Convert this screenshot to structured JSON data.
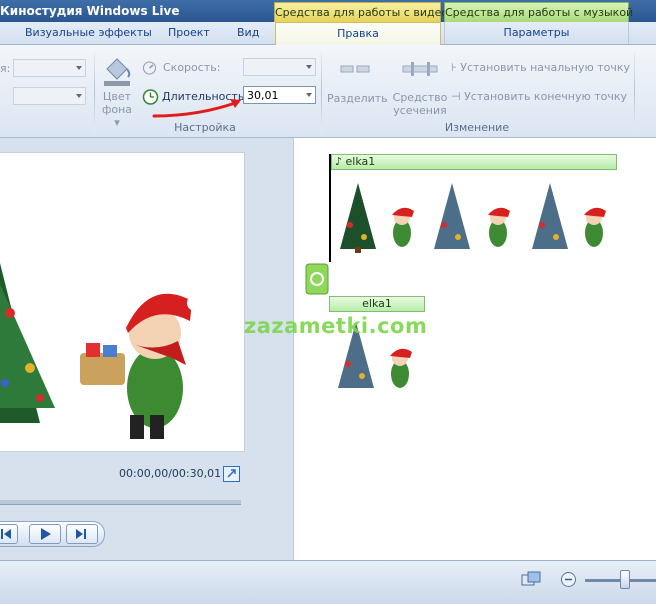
{
  "app": {
    "title": "Киностудия Windows Live"
  },
  "context_tabs": {
    "video": "Средства для работы с видео",
    "music": "Средства для работы с музыкой"
  },
  "tabs": {
    "visual_effects": "Визуальные эффекты",
    "project": "Проект",
    "view": "Вид",
    "edit": "Правка",
    "options": "Параметры"
  },
  "ribbon": {
    "partial_label": "я:",
    "bg_color_line1": "Цвет",
    "bg_color_line2": "фона",
    "speed_label": "Скорость:",
    "duration_label": "Длительность:",
    "duration_value": "30,01",
    "group_setup": "Настройка",
    "split_label": "Разделить",
    "trim_line1": "Средство",
    "trim_line2": "усечения",
    "set_start": "Установить начальную точку",
    "set_end": "Установить конечную точку",
    "group_edit": "Изменение"
  },
  "preview": {
    "timecode": "00:00,00/00:30,01"
  },
  "storyboard": {
    "audio_clip": "elka1",
    "video_clip": "elka1"
  },
  "watermark": {
    "text": "zazametki.com"
  },
  "colors": {
    "accent_video_tab": "#e6d35a",
    "accent_music_tab": "#a8d97a",
    "annotation_red": "#e31b1b"
  }
}
